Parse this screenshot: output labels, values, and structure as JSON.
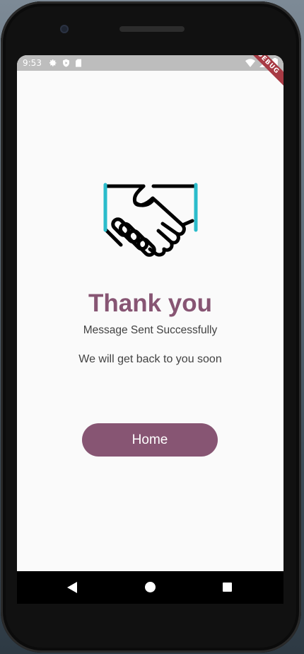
{
  "status_bar": {
    "time": "9:53",
    "left_icons": [
      "gear-icon",
      "shield-icon",
      "sd-card-icon"
    ],
    "right_icons": [
      "wifi-icon",
      "signal-icon",
      "battery-icon"
    ],
    "debug_banner": "DEBUG"
  },
  "content": {
    "illustration": "handshake-icon",
    "title": "Thank you",
    "subtitle": "Message Sent Successfully",
    "message": "We will get back to you soon",
    "home_button_label": "Home"
  },
  "nav_bar": {
    "buttons": [
      "back-icon",
      "home-icon",
      "recents-icon"
    ]
  },
  "colors": {
    "accent": "#875573",
    "handshake_accent": "#2bbccb",
    "status_bar": "#bdbdbd",
    "screen_background": "#fafafa",
    "debug_ribbon": "#a83a44"
  }
}
